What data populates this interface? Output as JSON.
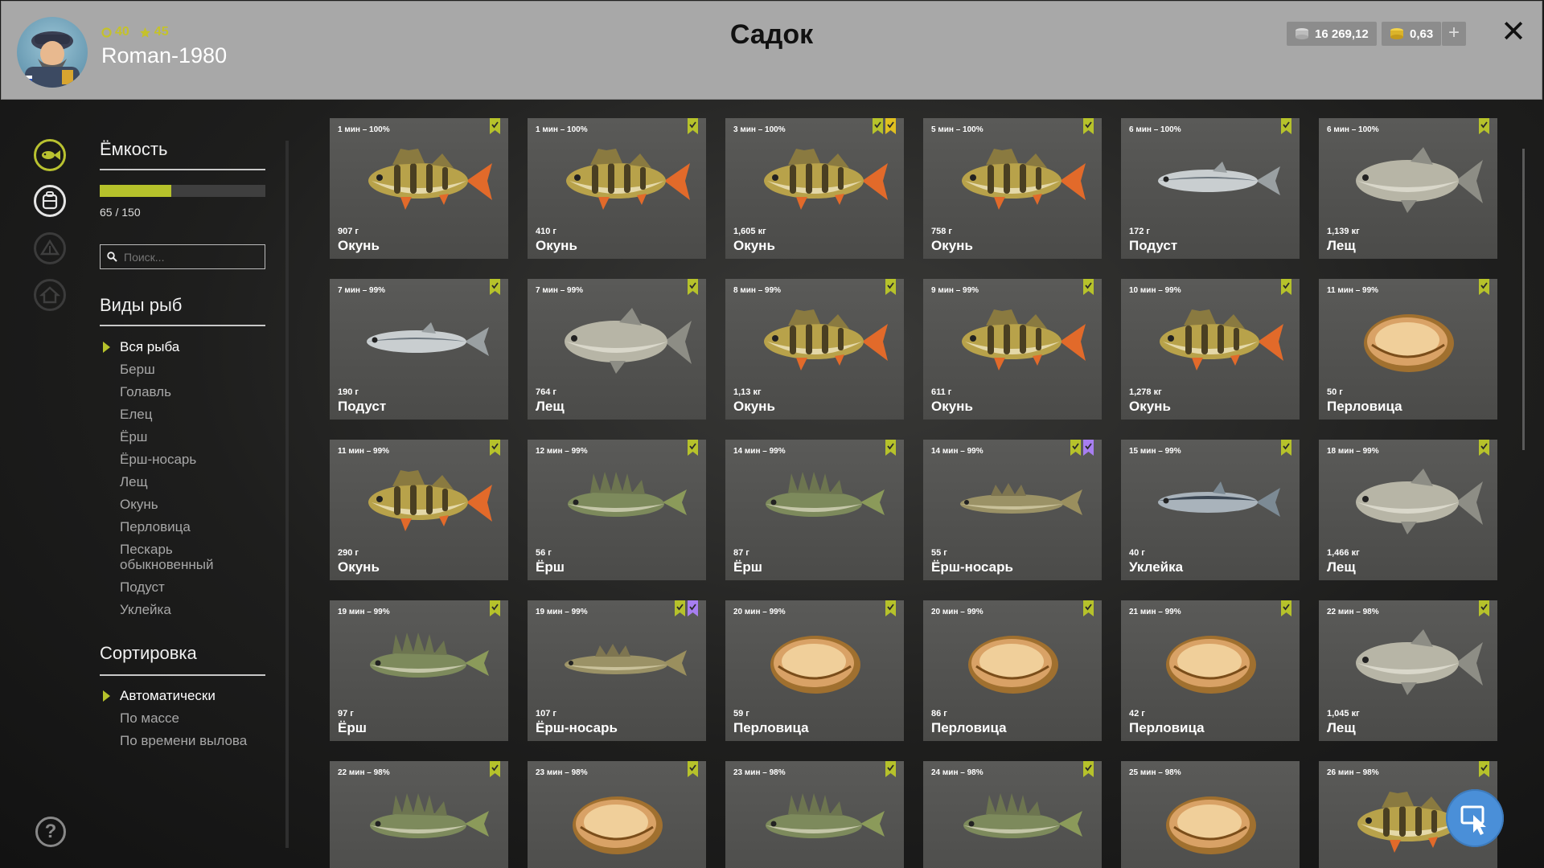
{
  "header": {
    "title": "Садок",
    "player_name": "Roman-1980",
    "level": "40",
    "stars": "45",
    "silver": "16 269,12",
    "gold": "0,63"
  },
  "sidebar": {
    "capacity_title": "Ёмкость",
    "capacity_text": "65 / 150",
    "capacity_fraction": 0.433,
    "search_placeholder": "Поиск...",
    "species_title": "Виды рыб",
    "species": [
      "Вся рыба",
      "Берш",
      "Голавль",
      "Елец",
      "Ёрш",
      "Ёрш-носарь",
      "Лещ",
      "Окунь",
      "Перловица",
      "Пескарь обыкновенный",
      "Подуст",
      "Уклейка"
    ],
    "species_active": 0,
    "sort_title": "Сортировка",
    "sort_options": [
      "Автоматически",
      "По массе",
      "По времени вылова"
    ],
    "sort_active": 0
  },
  "colors": {
    "accent": "#b6c22b",
    "badge_violet": "#a77ef0",
    "badge_gold": "#e0c020"
  },
  "fish": [
    {
      "time": "1 мин – 100%",
      "weight": "907 г",
      "name": "Окунь",
      "kind": "perch",
      "marks": [
        "green"
      ]
    },
    {
      "time": "1 мин – 100%",
      "weight": "410 г",
      "name": "Окунь",
      "kind": "perch",
      "marks": [
        "green"
      ]
    },
    {
      "time": "3 мин – 100%",
      "weight": "1,605 кг",
      "name": "Окунь",
      "kind": "perch",
      "marks": [
        "green",
        "gold"
      ]
    },
    {
      "time": "5 мин – 100%",
      "weight": "758 г",
      "name": "Окунь",
      "kind": "perch",
      "marks": [
        "green"
      ]
    },
    {
      "time": "6 мин – 100%",
      "weight": "172 г",
      "name": "Подуст",
      "kind": "silver",
      "marks": [
        "green"
      ]
    },
    {
      "time": "6 мин – 100%",
      "weight": "1,139 кг",
      "name": "Лещ",
      "kind": "bream",
      "marks": [
        "green"
      ]
    },
    {
      "time": "7 мин – 99%",
      "weight": "190 г",
      "name": "Подуст",
      "kind": "silver",
      "marks": [
        "green"
      ]
    },
    {
      "time": "7 мин – 99%",
      "weight": "764 г",
      "name": "Лещ",
      "kind": "bream",
      "marks": [
        "green"
      ]
    },
    {
      "time": "8 мин – 99%",
      "weight": "1,13 кг",
      "name": "Окунь",
      "kind": "perch",
      "marks": [
        "green"
      ]
    },
    {
      "time": "9 мин – 99%",
      "weight": "611 г",
      "name": "Окунь",
      "kind": "perch",
      "marks": [
        "green"
      ]
    },
    {
      "time": "10 мин – 99%",
      "weight": "1,278 кг",
      "name": "Окунь",
      "kind": "perch",
      "marks": [
        "green"
      ]
    },
    {
      "time": "11 мин – 99%",
      "weight": "50 г",
      "name": "Перловица",
      "kind": "mussel",
      "marks": [
        "green"
      ]
    },
    {
      "time": "11 мин – 99%",
      "weight": "290 г",
      "name": "Окунь",
      "kind": "perch",
      "marks": [
        "green"
      ]
    },
    {
      "time": "12 мин – 99%",
      "weight": "56 г",
      "name": "Ёрш",
      "kind": "ruffe",
      "marks": [
        "green"
      ]
    },
    {
      "time": "14 мин – 99%",
      "weight": "87 г",
      "name": "Ёрш",
      "kind": "ruffe",
      "marks": [
        "green"
      ]
    },
    {
      "time": "14 мин – 99%",
      "weight": "55 г",
      "name": "Ёрш-носарь",
      "kind": "pike",
      "marks": [
        "green",
        "violet"
      ]
    },
    {
      "time": "15 мин – 99%",
      "weight": "40 г",
      "name": "Уклейка",
      "kind": "bleak",
      "marks": [
        "green"
      ]
    },
    {
      "time": "18 мин – 99%",
      "weight": "1,466 кг",
      "name": "Лещ",
      "kind": "bream",
      "marks": [
        "green"
      ]
    },
    {
      "time": "19 мин – 99%",
      "weight": "97 г",
      "name": "Ёрш",
      "kind": "ruffe",
      "marks": [
        "green"
      ]
    },
    {
      "time": "19 мин – 99%",
      "weight": "107 г",
      "name": "Ёрш-носарь",
      "kind": "pike",
      "marks": [
        "green",
        "violet"
      ]
    },
    {
      "time": "20 мин – 99%",
      "weight": "59 г",
      "name": "Перловица",
      "kind": "mussel",
      "marks": [
        "green"
      ]
    },
    {
      "time": "20 мин – 99%",
      "weight": "86 г",
      "name": "Перловица",
      "kind": "mussel",
      "marks": [
        "green"
      ]
    },
    {
      "time": "21 мин – 99%",
      "weight": "42 г",
      "name": "Перловица",
      "kind": "mussel",
      "marks": [
        "green"
      ]
    },
    {
      "time": "22 мин – 98%",
      "weight": "1,045 кг",
      "name": "Лещ",
      "kind": "bream",
      "marks": [
        "green"
      ]
    },
    {
      "time": "22 мин – 98%",
      "weight": "",
      "name": "",
      "kind": "ruffe",
      "marks": [
        "green"
      ]
    },
    {
      "time": "23 мин – 98%",
      "weight": "",
      "name": "",
      "kind": "mussel",
      "marks": [
        "green"
      ]
    },
    {
      "time": "23 мин – 98%",
      "weight": "",
      "name": "",
      "kind": "ruffe",
      "marks": [
        "green"
      ]
    },
    {
      "time": "24 мин – 98%",
      "weight": "",
      "name": "",
      "kind": "ruffe",
      "marks": [
        "green"
      ]
    },
    {
      "time": "25 мин – 98%",
      "weight": "",
      "name": "",
      "kind": "mussel",
      "marks": []
    },
    {
      "time": "26 мин – 98%",
      "weight": "",
      "name": "",
      "kind": "perch",
      "marks": [
        "green"
      ]
    }
  ]
}
